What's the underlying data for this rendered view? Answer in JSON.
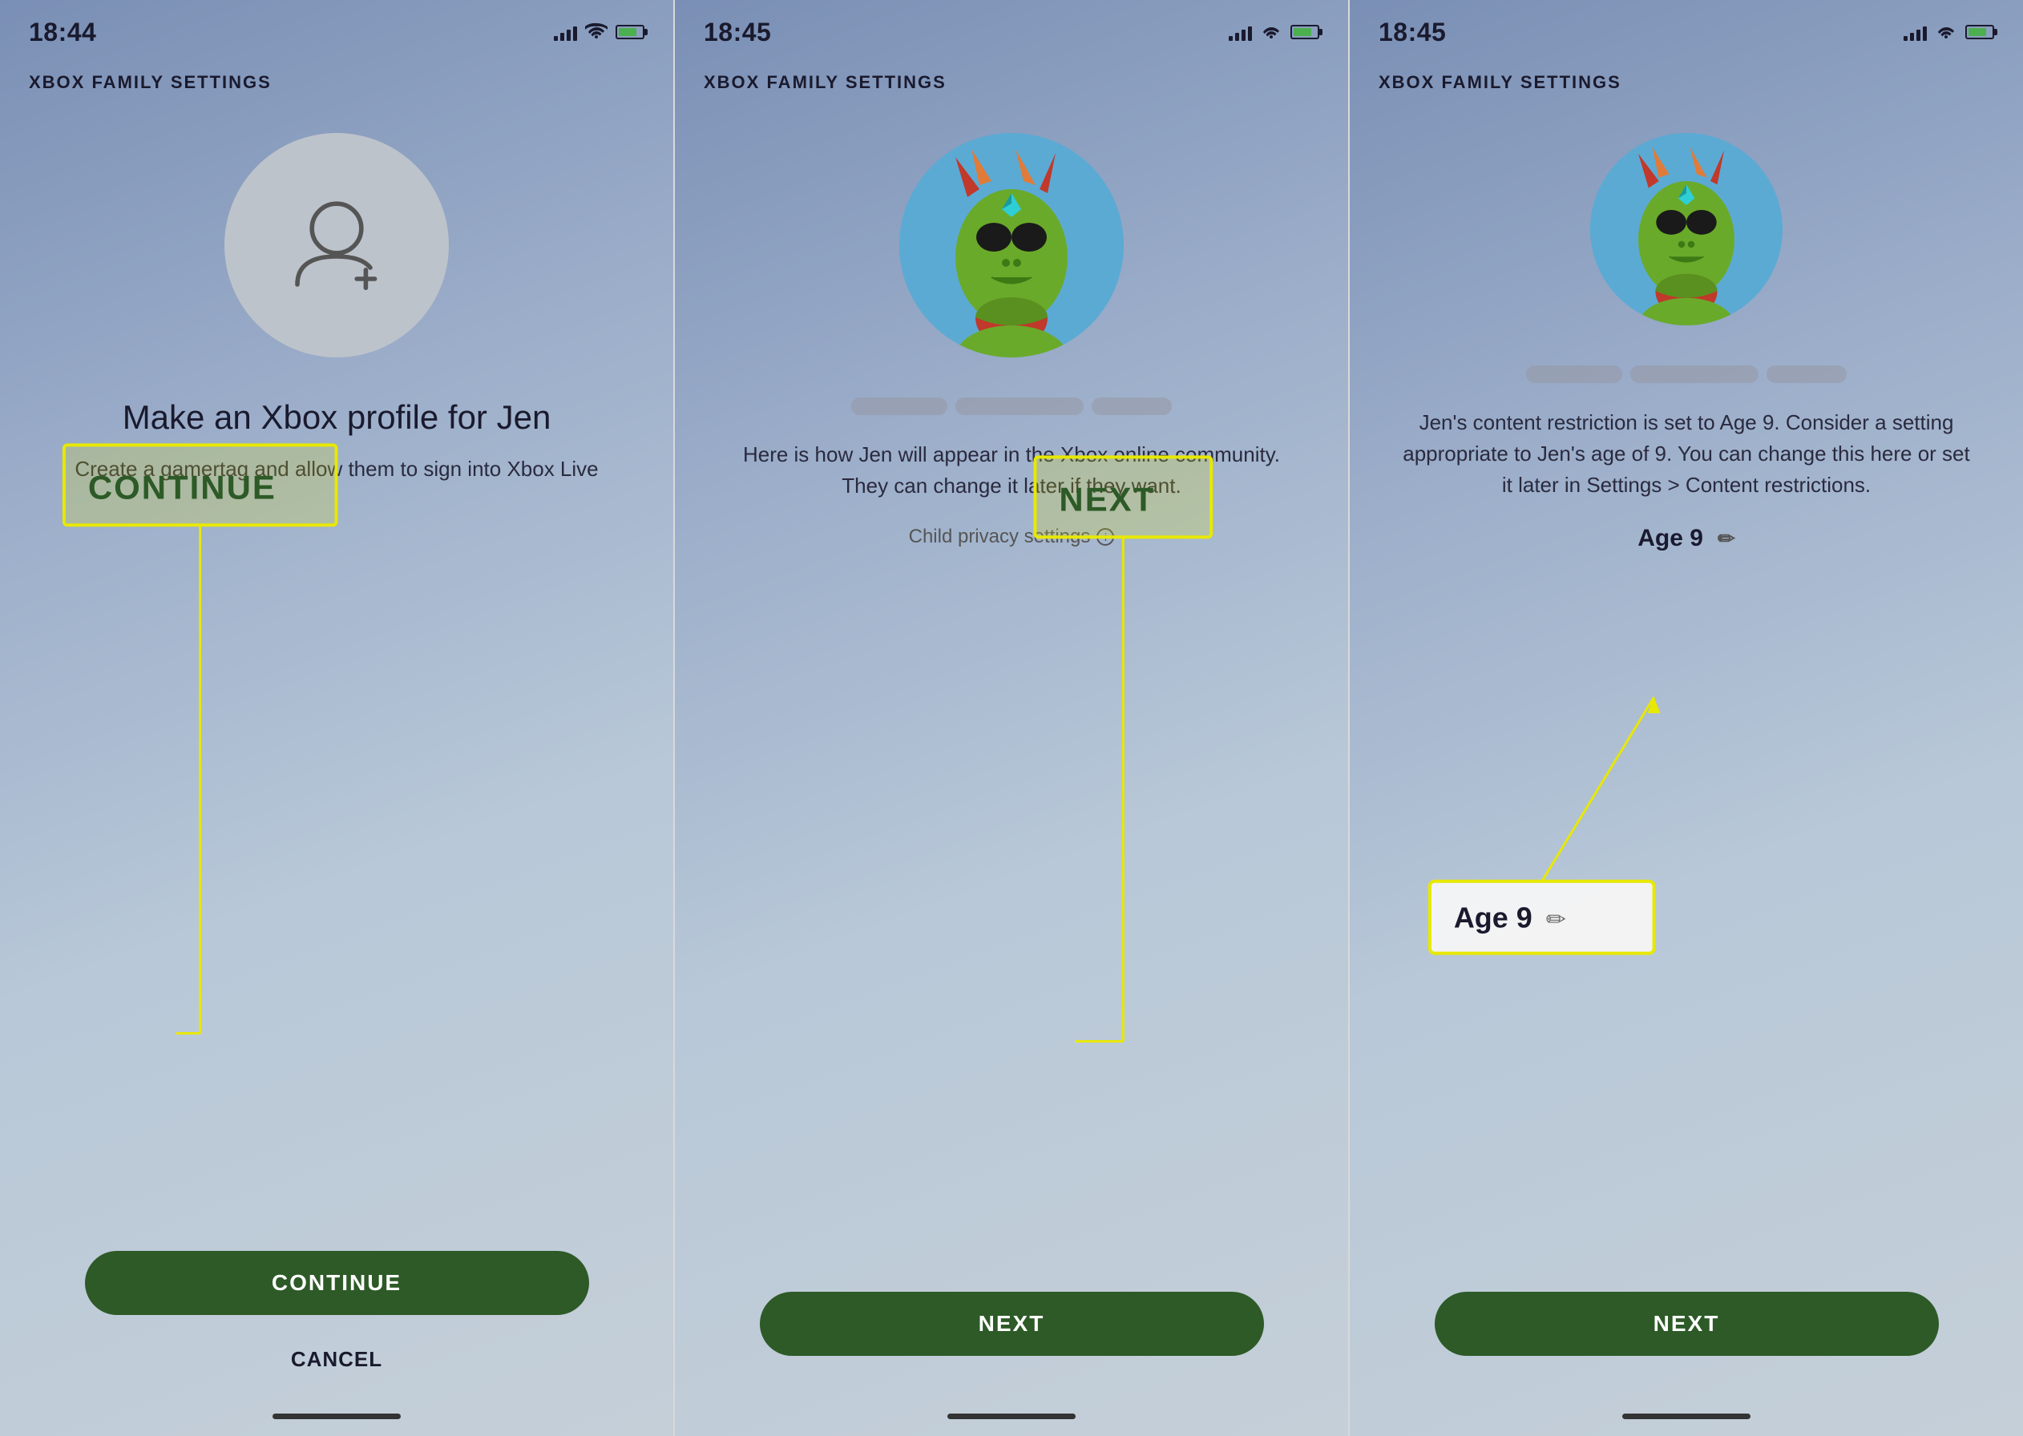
{
  "screens": [
    {
      "id": "screen-1",
      "status_time": "18:44",
      "app_title": "XBOX FAMILY SETTINGS",
      "avatar_type": "placeholder",
      "screen_title": "Make an Xbox profile for Jen",
      "screen_subtitle": "Create a gamertag and allow them to sign into Xbox Live",
      "primary_button": "CONTINUE",
      "secondary_button": "CANCEL",
      "annotation_label": "CONTINUE"
    },
    {
      "id": "screen-2",
      "status_time": "18:45",
      "app_title": "XBOX FAMILY SETTINGS",
      "avatar_type": "character",
      "gamertag_bars": [
        60,
        80,
        50
      ],
      "screen_description": "Here is how Jen will appear in the Xbox online community. They can change it later if they want.",
      "privacy_text": "Child privacy settings",
      "primary_button": "NEXT",
      "annotation_label": "NEXT"
    },
    {
      "id": "screen-3",
      "status_time": "18:45",
      "app_title": "XBOX FAMILY SETTINGS",
      "avatar_type": "character",
      "gamertag_bars": [
        60,
        80,
        50
      ],
      "screen_description": "Jen's content restriction is set to Age 9. Consider a setting appropriate to Jen's age of 9. You can change this here or set it later in Settings > Content restrictions.",
      "age_label": "Age 9",
      "primary_button": "NEXT",
      "annotation_label": "Age 9",
      "annotation_edit": "✏"
    }
  ],
  "annotation_colors": {
    "box": "#e8e800",
    "line": "#e8e800",
    "label_bg": "#2d5a27",
    "label_text": "#ffffff"
  }
}
